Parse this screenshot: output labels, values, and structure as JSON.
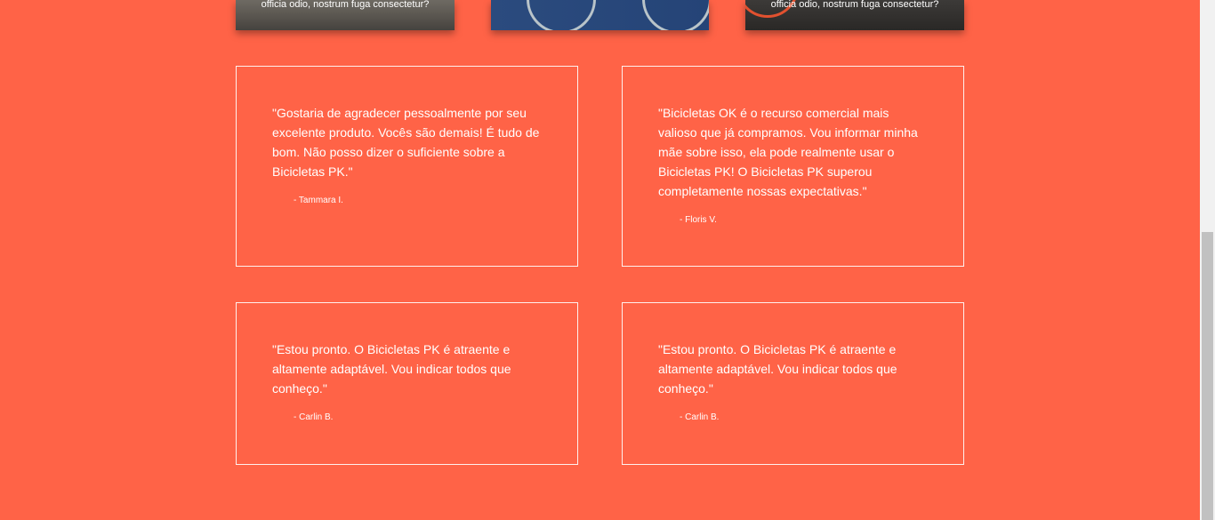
{
  "gallery": {
    "cards": [
      {
        "caption": "officia odio, nostrum fuga consectetur?"
      },
      {
        "caption": ""
      },
      {
        "caption": "officia odio, nostrum fuga consectetur?"
      }
    ]
  },
  "testimonials": [
    {
      "quote": "\"Gostaria de agradecer pessoalmente por seu excelente produto. Vocês são demais! É tudo de bom. Não posso dizer o suficiente sobre a Bicicletas PK.\"",
      "author": "- Tammara I."
    },
    {
      "quote": "\"Bicicletas OK é o recurso comercial mais valioso que já compramos. Vou informar minha mãe sobre isso, ela pode realmente usar o Bicicletas PK! O Bicicletas PK superou completamente nossas expectativas.\"",
      "author": "- Floris V."
    },
    {
      "quote": "\"Estou pronto. O Bicicletas PK é atraente e altamente adaptável. Vou indicar todos que conheço.\"",
      "author": "- Carlin B."
    },
    {
      "quote": "\"Estou pronto. O Bicicletas PK é atraente e altamente adaptável. Vou indicar todos que conheço.\"",
      "author": "- Carlin B."
    }
  ],
  "colors": {
    "background": "#ff6347",
    "text": "#ffffff",
    "border": "#ffffff"
  }
}
